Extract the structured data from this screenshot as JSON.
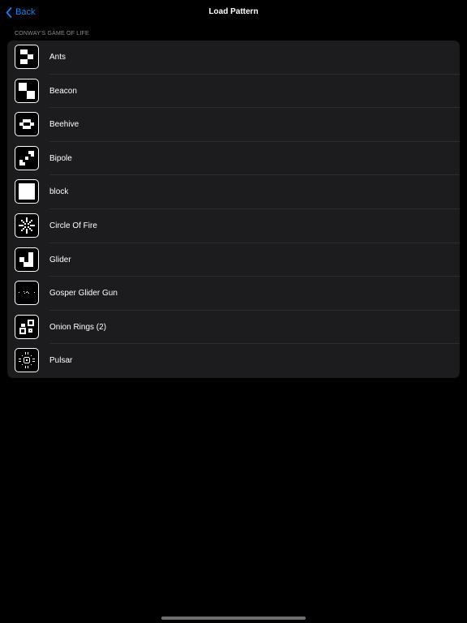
{
  "nav": {
    "back_label": "Back",
    "title": "Load Pattern"
  },
  "section": {
    "header": "CONWAY'S GAME OF LIFE",
    "items": [
      {
        "label": "Ants",
        "icon": "ants-pattern-icon"
      },
      {
        "label": "Beacon",
        "icon": "beacon-pattern-icon"
      },
      {
        "label": "Beehive",
        "icon": "beehive-pattern-icon"
      },
      {
        "label": "Bipole",
        "icon": "bipole-pattern-icon"
      },
      {
        "label": "block",
        "icon": "block-pattern-icon"
      },
      {
        "label": "Circle Of Fire",
        "icon": "circle-of-fire-pattern-icon"
      },
      {
        "label": "Glider",
        "icon": "glider-pattern-icon"
      },
      {
        "label": "Gosper Glider Gun",
        "icon": "gosper-glider-gun-pattern-icon"
      },
      {
        "label": "Onion Rings (2)",
        "icon": "onion-rings-pattern-icon"
      },
      {
        "label": "Pulsar",
        "icon": "pulsar-pattern-icon"
      }
    ]
  },
  "colors": {
    "accent": "#0a84ff",
    "background": "#000000",
    "list_background": "#1c1c1e",
    "separator": "#2c2c2e",
    "secondary_text": "#8e8e93"
  }
}
